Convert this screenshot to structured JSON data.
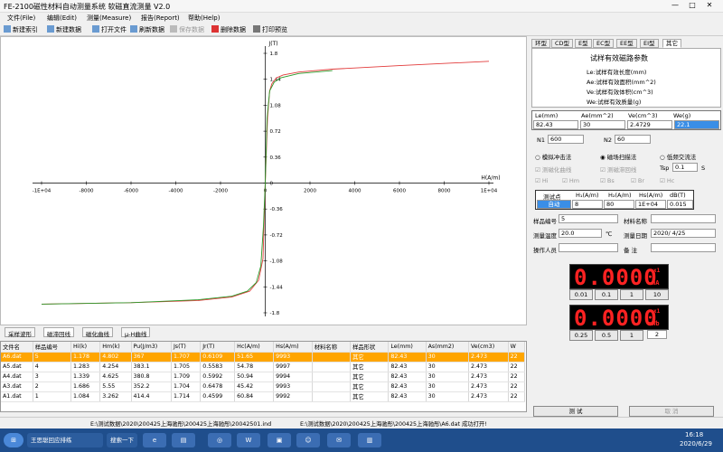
{
  "window": {
    "title": "FE-2100磁性材料自动测量系统 软磁直流测量 V2.0",
    "min": "—",
    "max": "□",
    "close": "✕"
  },
  "menu": [
    "文件(File)",
    "编辑(Edit)",
    "测量(Measure)",
    "报告(Report)",
    "帮助(Help)"
  ],
  "toolbar": {
    "new_cb": "新建索引",
    "new_data": "新建数据",
    "open_file": "打开文件",
    "refresh": "刷新数据",
    "save": "保存数据",
    "delete": "删除数据",
    "print_preview": "打印预览"
  },
  "chart_data": {
    "type": "line",
    "x_axis_label": "H(A/m)",
    "y_axis_label": "J(T)",
    "x_ticks": [
      "-1E+04",
      "-8000",
      "-6000",
      "-4000",
      "-2000",
      "0",
      "2000",
      "4000",
      "6000",
      "8000",
      "1E+04"
    ],
    "y_ticks": [
      "1.8",
      "1.44",
      "1.08",
      "0.72",
      "0.36",
      "0",
      "-0.36",
      "-0.72",
      "-1.08",
      "-1.44",
      "-1.8"
    ],
    "xlim": [
      -10000,
      10000
    ],
    "ylim": [
      -1.8,
      1.8
    ],
    "grid": false,
    "series": [
      {
        "color": "#e23b3b",
        "x": [
          -10000,
          -6000,
          -3000,
          -1500,
          -700,
          -300,
          -100,
          0,
          100,
          200,
          300,
          500,
          800,
          1500,
          3000,
          6000,
          10000
        ],
        "y": [
          -1.68,
          -1.66,
          -1.63,
          -1.58,
          -1.5,
          -1.35,
          -1.05,
          0,
          0.9,
          1.28,
          1.38,
          1.46,
          1.5,
          1.54,
          1.58,
          1.63,
          1.69
        ]
      },
      {
        "color": "#2a9a2a",
        "x": [
          -10000,
          -6000,
          -3000,
          -1500,
          -800,
          -400,
          -200,
          -80,
          0,
          80,
          200,
          400,
          700,
          1500,
          3000
        ],
        "y": [
          -1.68,
          -1.66,
          -1.62,
          -1.57,
          -1.5,
          -1.38,
          -1.15,
          -0.6,
          0,
          0.9,
          1.28,
          1.4,
          1.46,
          1.52,
          1.56
        ]
      }
    ]
  },
  "chart_tabs": [
    "采样波形",
    "磁滞回线",
    "磁化曲线",
    "μ-H曲线"
  ],
  "grid": {
    "columns": [
      "文件名",
      "样品编号",
      "Hi(k)",
      "Hm(k)",
      "Pu(J/m3)",
      "Js(T)",
      "Jr(T)",
      "Hc(A/m)",
      "Hs(A/m)",
      "材料名称",
      "样品形状",
      "Le(mm)",
      "As(mm2)",
      "Ve(cm3)",
      "W"
    ],
    "rows": [
      [
        "A6.dat",
        "5",
        "1.178",
        "4.802",
        "367",
        "1.707",
        "0.6109",
        "51.65",
        "9993",
        "",
        "其它",
        "82.43",
        "30",
        "2.473",
        "22"
      ],
      [
        "A5.dat",
        "4",
        "1.283",
        "4.254",
        "383.1",
        "1.705",
        "0.5583",
        "54.78",
        "9997",
        "",
        "其它",
        "82.43",
        "30",
        "2.473",
        "22"
      ],
      [
        "A4.dat",
        "3",
        "1.339",
        "4.625",
        "380.8",
        "1.709",
        "0.5992",
        "50.94",
        "9994",
        "",
        "其它",
        "82.43",
        "30",
        "2.473",
        "22"
      ],
      [
        "A3.dat",
        "2",
        "1.686",
        "5.55",
        "352.2",
        "1.704",
        "0.6478",
        "45.42",
        "9993",
        "",
        "其它",
        "82.43",
        "30",
        "2.473",
        "22"
      ],
      [
        "A1.dat",
        "1",
        "1.084",
        "3.262",
        "414.4",
        "1.714",
        "0.4599",
        "60.84",
        "9992",
        "",
        "其它",
        "82.43",
        "30",
        "2.473",
        "22"
      ]
    ]
  },
  "status": {
    "path": "E:\\测试数据\\2020\\200425上海驰彤\\200425上海驰彤\\20042501.ind",
    "msg": "E:\\测试数据\\2020\\200425上海驰彤\\200425上海驰彤\\A6.dat 成功打开!"
  },
  "right": {
    "tabs": [
      "环型",
      "CD型",
      "E型",
      "EC型",
      "EE型",
      "EI型",
      "其它"
    ],
    "params_title": "试样有效磁路参数",
    "params": [
      "Le:试样有效长度(mm)",
      "Ae:试样有效面积(mm^2)",
      "Ve:试样有效体积(cm^3)",
      "We:试样有效质量(g)"
    ],
    "param_headers": [
      "Le(mm)",
      "Ae(mm^2)",
      "Ve(cm^3)",
      "We(g)"
    ],
    "param_values": [
      "82.43",
      "30",
      "2.4729",
      "22.1"
    ],
    "n1_label": "N1",
    "n1": "600",
    "n2_label": "N2",
    "n2": "60",
    "radio": [
      "模拟冲击法",
      "磁场扫描法",
      "低频交流法"
    ],
    "chk_a": [
      "测磁化曲线",
      "测磁滞回线"
    ],
    "tsp_label": "Tsp",
    "tsp": "0.1",
    "tsp_unit": "S",
    "chk_b": [
      "Hi",
      "Hm",
      "Bs",
      "Br",
      "Hc"
    ],
    "ptbl_headers": [
      "测试点",
      "H₁(A/m)",
      "H₂(A/m)",
      "Hs(A/m)",
      "dB(T)"
    ],
    "ptbl_values": [
      "自动",
      "8",
      "80",
      "1E+04",
      "0.015"
    ],
    "sample_no_label": "样品编号",
    "sample_no": "5",
    "mat_label": "材料名称",
    "mat": "",
    "temp_label": "测量温度",
    "temp": "20.0",
    "temp_unit": "℃",
    "date_label": "测量日期",
    "date": "2020/ 4/25",
    "op_label": "操作人员",
    "op": "",
    "note_label": "备   注",
    "note": "",
    "led1": {
      "value": "0.0000",
      "exp": "x1",
      "unit": "mA",
      "ranges": [
        "0.01",
        "0.1",
        "1",
        "10"
      ]
    },
    "led2": {
      "value": "0.0000",
      "exp": "x1",
      "unit": "mWb",
      "ranges": [
        "0.25",
        "0.5",
        "1"
      ],
      "extra": "2"
    },
    "test_btn": "测  试",
    "cancel_btn": "取  消"
  },
  "taskbar": {
    "item": "王思聪回应排练",
    "search": "搜索一下",
    "time": "16:18",
    "date": "2020/6/29"
  }
}
